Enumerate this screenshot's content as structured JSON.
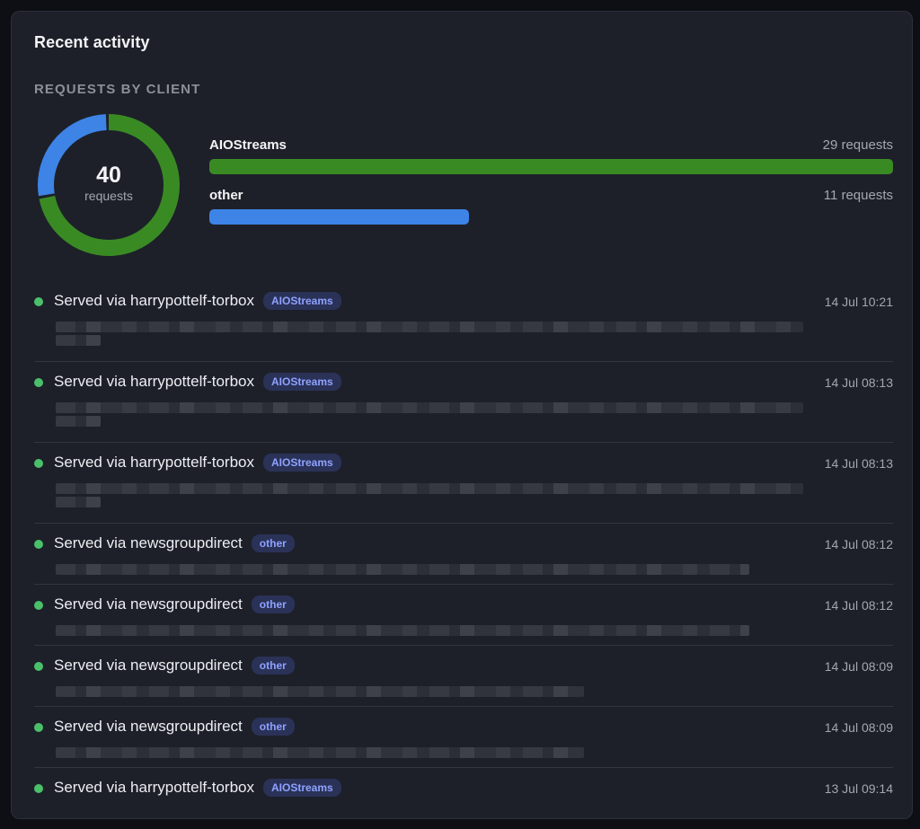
{
  "card": {
    "title": "Recent activity",
    "section_label": "REQUESTS BY CLIENT"
  },
  "donut": {
    "total": "40",
    "unit": "requests",
    "segments": [
      {
        "name": "AIOStreams",
        "value": 29,
        "color": "#3a8a24"
      },
      {
        "name": "other",
        "value": 11,
        "color": "#3d84e6"
      }
    ]
  },
  "clients": [
    {
      "name": "AIOStreams",
      "count_label": "29 requests",
      "value": 29,
      "color": "#3a8a24"
    },
    {
      "name": "other",
      "count_label": "11 requests",
      "value": 11,
      "color": "#3d84e6"
    }
  ],
  "activity": [
    {
      "title": "Served via harrypottelf-torbox",
      "badge": "AIOStreams",
      "time": "14 Jul 10:21"
    },
    {
      "title": "Served via harrypottelf-torbox",
      "badge": "AIOStreams",
      "time": "14 Jul 08:13"
    },
    {
      "title": "Served via harrypottelf-torbox",
      "badge": "AIOStreams",
      "time": "14 Jul 08:13"
    },
    {
      "title": "Served via newsgroupdirect",
      "badge": "other",
      "time": "14 Jul 08:12"
    },
    {
      "title": "Served via newsgroupdirect",
      "badge": "other",
      "time": "14 Jul 08:12"
    },
    {
      "title": "Served via newsgroupdirect",
      "badge": "other",
      "time": "14 Jul 08:09"
    },
    {
      "title": "Served via newsgroupdirect",
      "badge": "other",
      "time": "14 Jul 08:09"
    },
    {
      "title": "Served via harrypottelf-torbox",
      "badge": "AIOStreams",
      "time": "13 Jul 09:14"
    }
  ]
}
